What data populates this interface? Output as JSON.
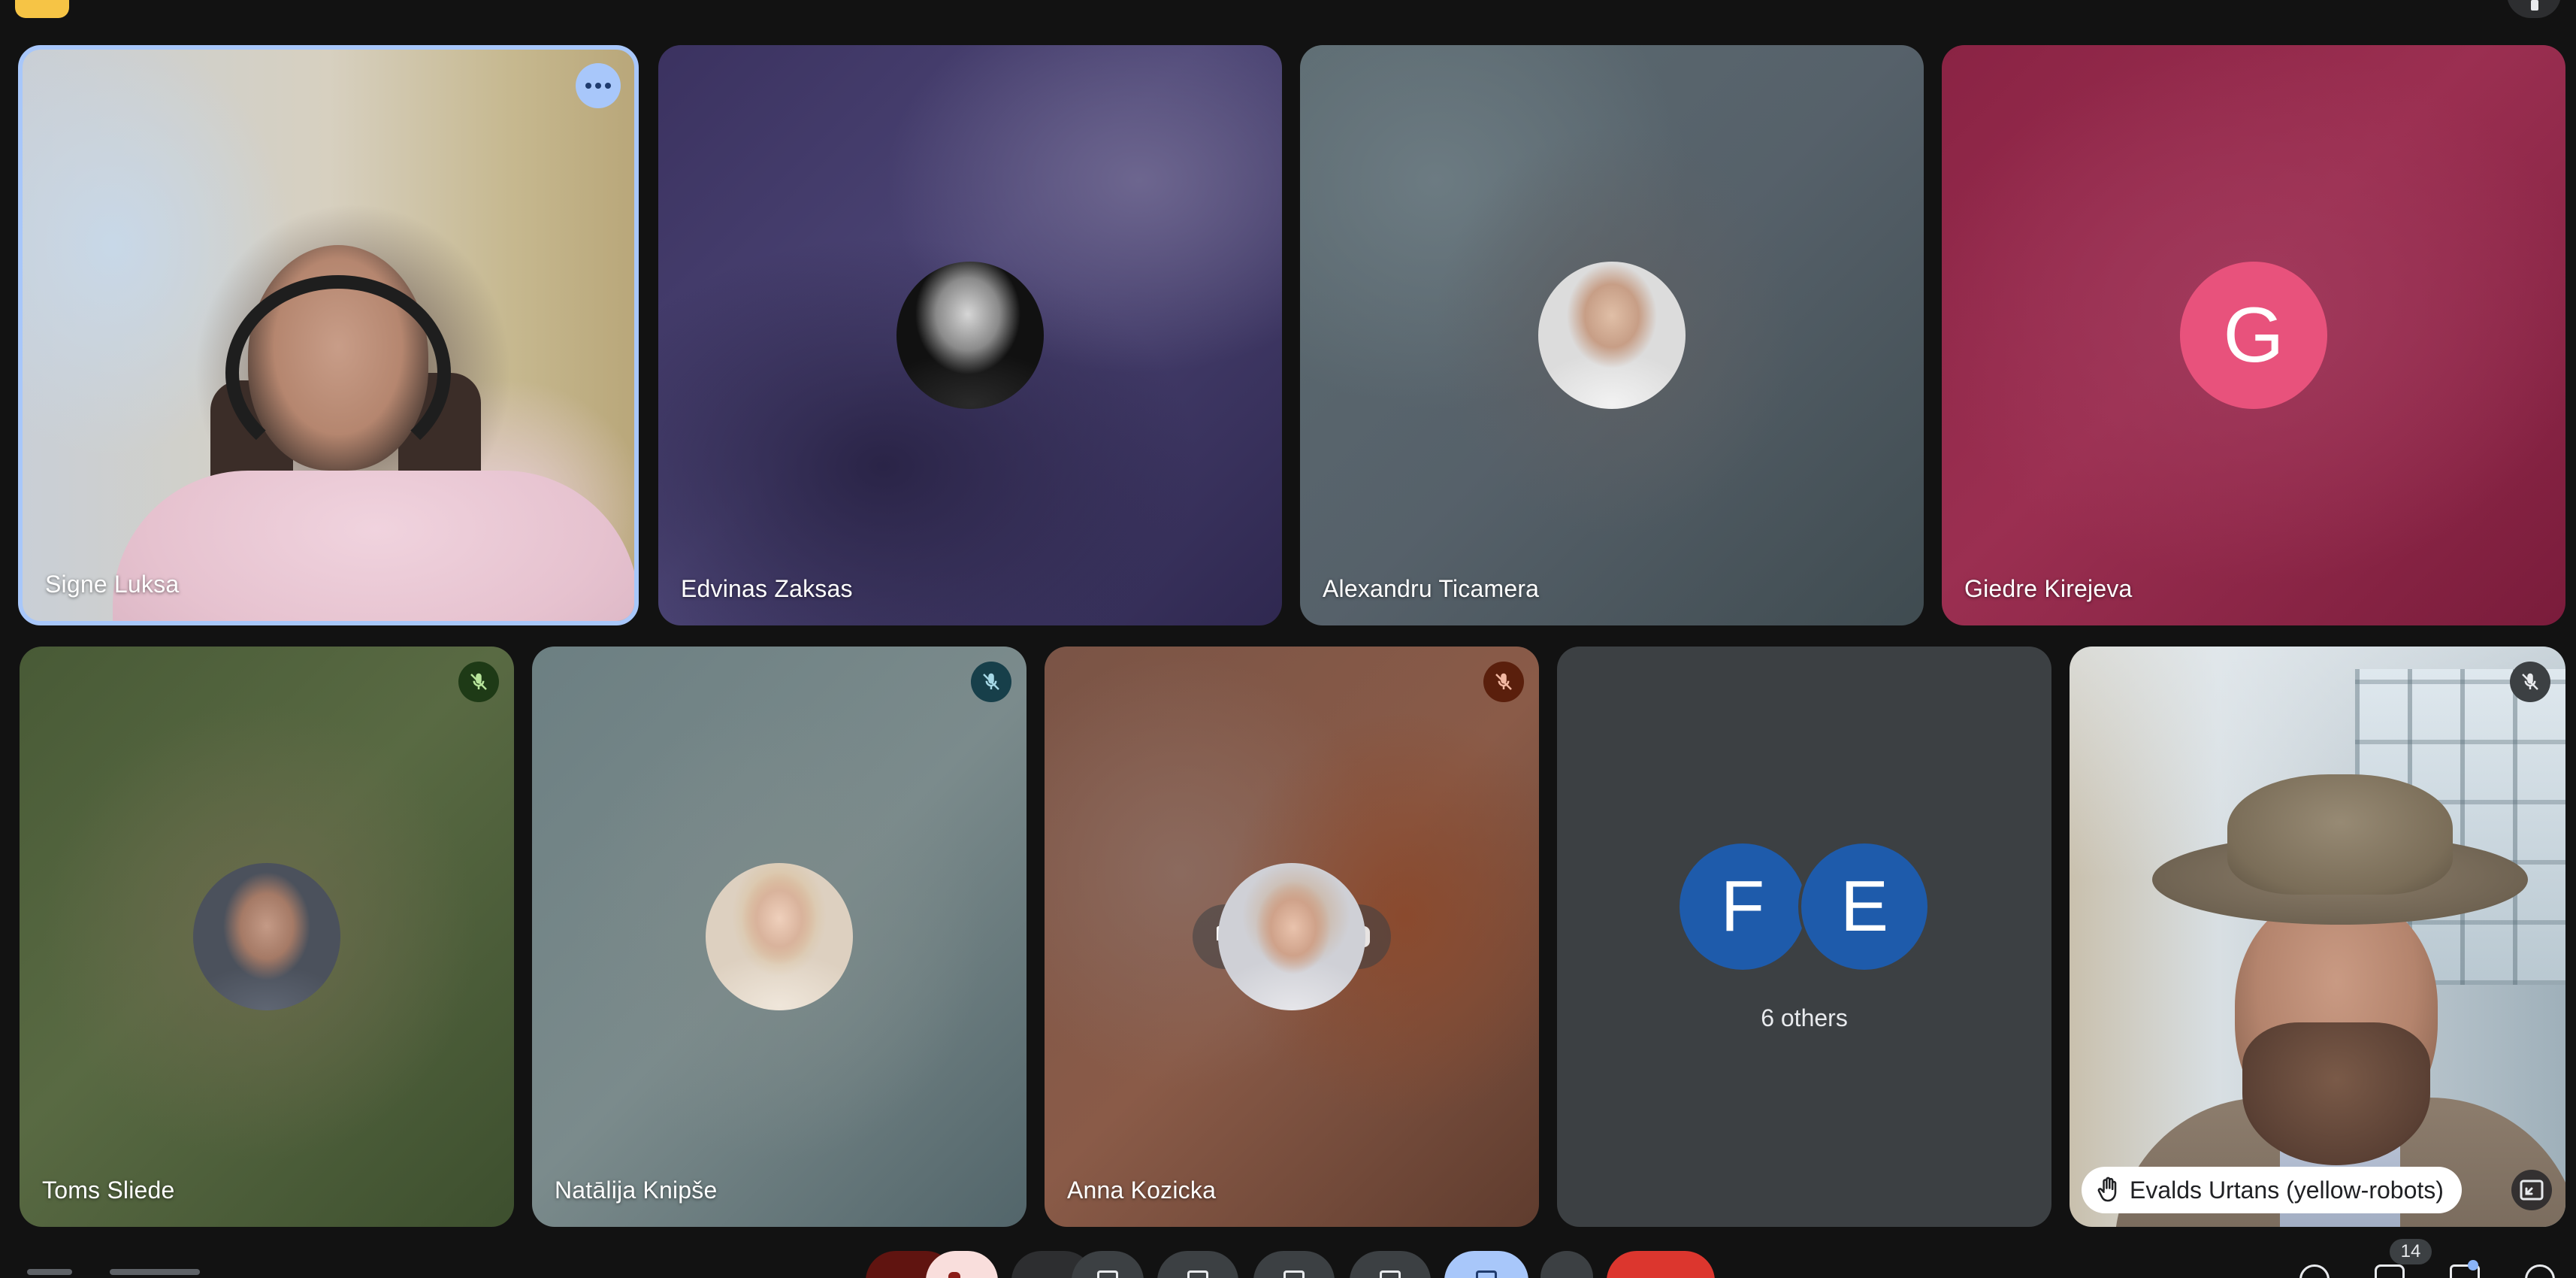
{
  "participants": {
    "signe": {
      "name": "Signe Luksa"
    },
    "edvinas": {
      "name": "Edvinas Zaksas"
    },
    "alexandru": {
      "name": "Alexandru Ticamera"
    },
    "giedre": {
      "name": "Giedre Kirejeva",
      "initial": "G",
      "avatar_color": "#e8527c"
    },
    "toms": {
      "name": "Toms Sliede",
      "mute_badge_color": "#1e3a16"
    },
    "natalija": {
      "name": "Natālija Knipše",
      "mute_badge_color": "#173f4a"
    },
    "anna": {
      "name": "Anna Kozicka",
      "mute_badge_color": "#5a1f0c"
    },
    "others": {
      "initials": [
        "F",
        "E"
      ],
      "label": "6 others",
      "avatar_color": "#1e5bab"
    },
    "evalds": {
      "name": "Evalds Urtans (yellow-robots)",
      "hand_raised": true,
      "mute_badge_color": "#3c4043"
    }
  },
  "toolbar": {
    "people_count": "14",
    "hand_raise_active_color": "#a8c7fa",
    "end_call_color": "#dc362e",
    "mic_muted_color": "#601410"
  },
  "colors": {
    "background": "#121212",
    "active_speaker_border": "#a8c7fa",
    "tile": "#3c4043"
  }
}
